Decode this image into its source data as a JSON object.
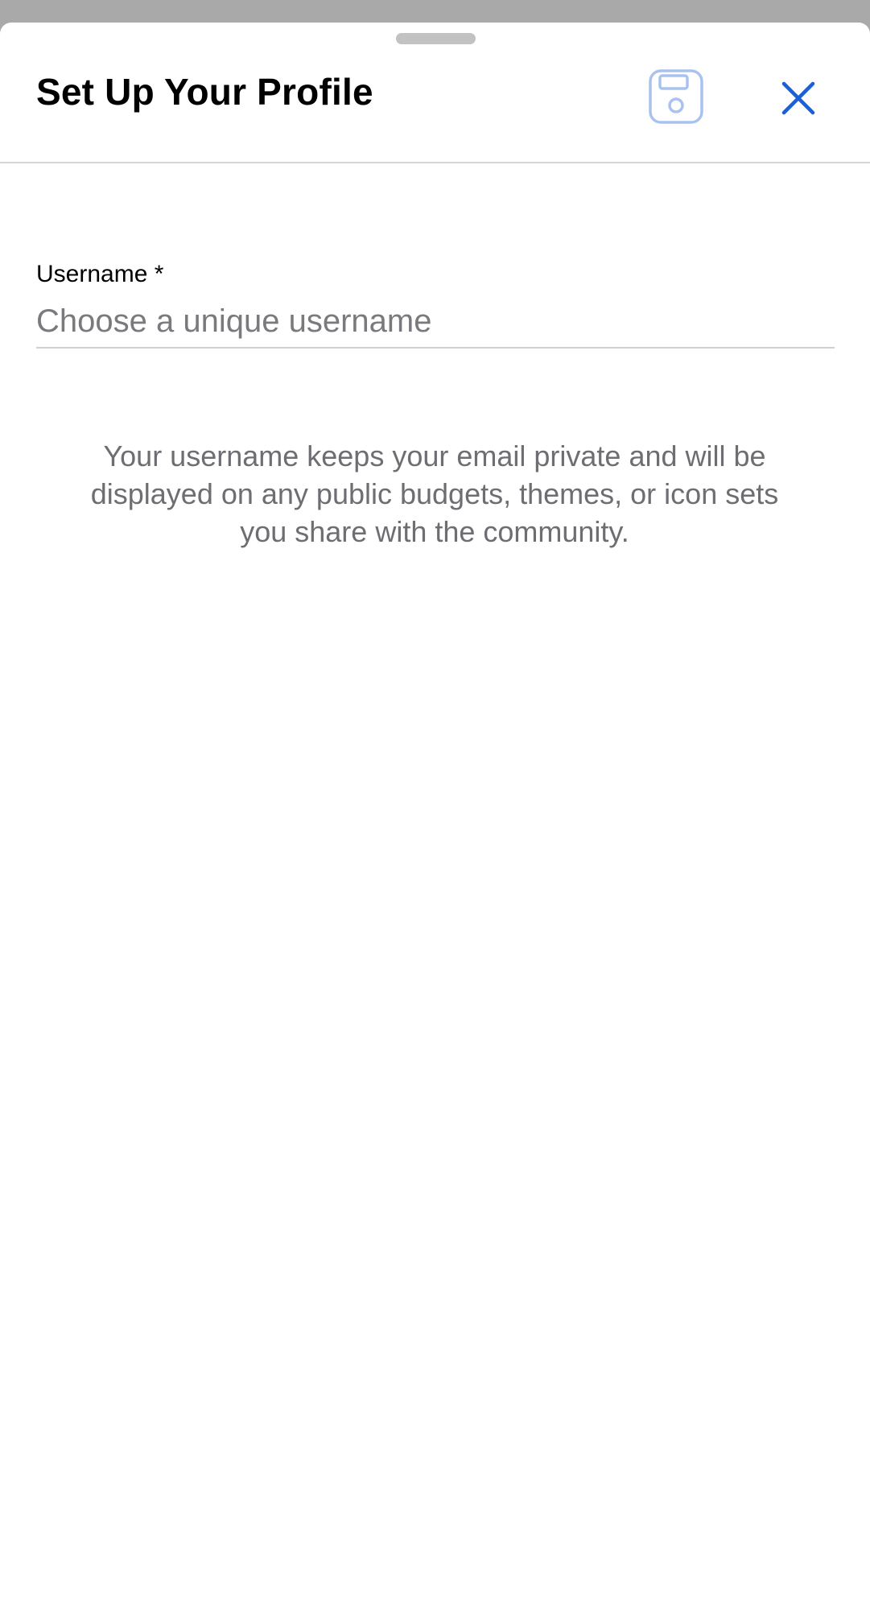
{
  "sheet": {
    "title": "Set Up Your Profile",
    "save_icon": "floppy-disk-icon",
    "close_icon": "close-x-icon"
  },
  "form": {
    "username_label": "Username *",
    "username_value": "",
    "username_placeholder": "Choose a unique username"
  },
  "helper_text": "Your username keeps your email private and will be displayed on any public budgets, themes, or icon sets you share with the community.",
  "colors": {
    "accent": "#1a5fd6",
    "save_icon_disabled": "#a9c3ee",
    "dimmed_background": "#a9a9a9",
    "divider": "#d6d6d6",
    "secondary_text": "#6d6d72"
  }
}
